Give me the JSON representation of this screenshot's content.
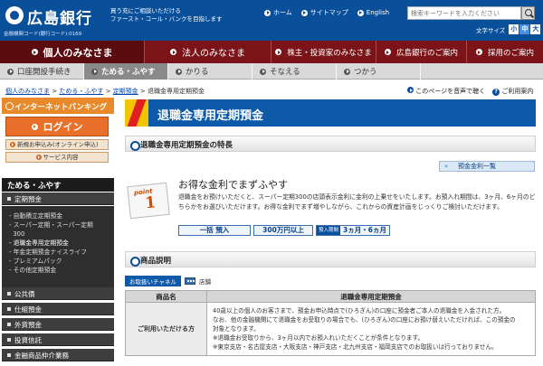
{
  "header": {
    "logo_text": "広島銀行",
    "bank_code": "金融機関コード(銀行コード):0169",
    "slogan_line1": "買う充にご相談いただける",
    "slogan_line2": "ファースト・コール・バンクを目指します",
    "links": [
      "ホーム",
      "サイトマップ",
      "English"
    ],
    "search_placeholder": "検索キーワードを入力ください",
    "font_size_label": "文字サイズ",
    "font_sizes": [
      "小",
      "中",
      "大"
    ],
    "active_font_size": "中"
  },
  "main_nav": {
    "tabs": [
      "個人のみなさま",
      "法人のみなさま",
      "株主・投資家のみなさま",
      "広島銀行のご案内",
      "採用のご案内"
    ]
  },
  "sub_nav": {
    "tabs": [
      "口座開設手続き",
      "ためる・ふやす",
      "かりる",
      "そなえる",
      "つかう"
    ]
  },
  "breadcrumb": {
    "items": [
      "個人のみなさま",
      "ためる・ふやす",
      "定期預金",
      "退職金専用定期預金"
    ],
    "separator": ">"
  },
  "page_tools": {
    "listen": "このページを音声で聴く",
    "terms": "ご利用案内"
  },
  "sidebar": {
    "ib_header": "インターネットバンキング",
    "login_label": "ログイン",
    "new_apply": "新規お申込み(オンライン申込)",
    "service_detail": "サービス内容",
    "section_title": "ためる・ふやす",
    "category_active": "定期預金",
    "sub_items": [
      "自動積立定期預金",
      "スーパー定期・スーパー定期",
      "300",
      "退職金専用定期預金",
      "年金定期預金ナイスライフ",
      "プレミアムパック",
      "その他定期預金"
    ],
    "categories": [
      "公共債",
      "仕組預金",
      "外貨預金",
      "投資信託",
      "金融商品仲介業務"
    ]
  },
  "main": {
    "page_title": "退職金専用定期預金",
    "feature_section_title": "退職金専用定期預金の特長",
    "rate_button": "預金金利一覧",
    "point_label": "point",
    "point_number": "1",
    "feature_title": "お得な金利でまずふやす",
    "feature_desc": "退職金をお預けいただくと、スーパー定期300の店頭表示金利に金利の上乗せをいたします。お預入れ期間は、3ヶ月、6ヶ月のどちらかをお選びいただけます。お得な金利でまず増やしながら、これからの資産計画をじっくりご検討いただけます。",
    "badge_lump": "一括 預入",
    "badge_amount": "300万円以上",
    "badge_term_label": "預入期間",
    "badge_term_value": "3ヵ月・6ヵ月",
    "product_section_title": "商品説明",
    "channel_label": "お取扱いチャネル",
    "channel_value": "店舗",
    "table": {
      "col1": "商品名",
      "col2": "退職金専用定期預金",
      "row_label": "ご利用いただける方",
      "row_lines": [
        "40歳以上の個人のお客さまで、預金お申込時点で(ひろぎん)の口座に預金者ご本人の退職金を入金された方。",
        "なお、他の金融機関にて退職金をお受取りの場合でも、(ひろぎん)の口座にお預け替えいただければ、この預金の",
        "対象となります。",
        "※退職金お受取りから、3ヶ月以内でお預入れいただくことが条件となります。",
        "※東京支店・名古屋支店・大阪支店・神戸支店・北九州支店・福岡支店でのお取扱いは行っておりません。"
      ]
    }
  }
}
